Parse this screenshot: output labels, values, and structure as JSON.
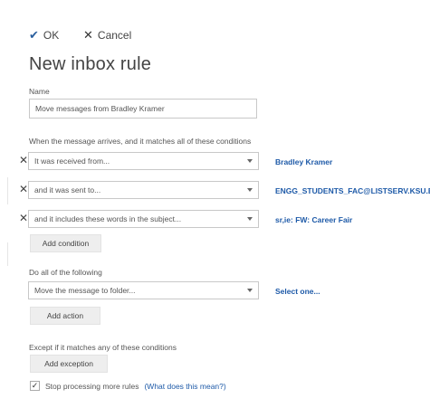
{
  "toolbar": {
    "ok_label": "OK",
    "cancel_label": "Cancel"
  },
  "page": {
    "title": "New inbox rule"
  },
  "name_section": {
    "label": "Name",
    "value": "Move messages from Bradley Kramer"
  },
  "conditions": {
    "heading": "When the message arrives, and it matches all of these conditions",
    "rows": [
      {
        "select": "It was received from...",
        "value": "Bradley Kramer"
      },
      {
        "select": "and it was sent to...",
        "value": "ENGG_STUDENTS_FAC@LISTSERV.KSU.EDU"
      },
      {
        "select": "and it includes these words in the subject...",
        "value": "sr,ie: FW: Career Fair"
      }
    ],
    "add_label": "Add condition"
  },
  "actions": {
    "heading": "Do all of the following",
    "select": "Move the message to folder...",
    "value": "Select one...",
    "add_label": "Add action"
  },
  "exceptions": {
    "heading": "Except if it matches any of these conditions",
    "add_label": "Add exception"
  },
  "stop_processing": {
    "checked": true,
    "check_glyph": "✓",
    "label": "Stop processing more rules",
    "help": "(What does this mean?)"
  },
  "icons": {
    "ok": "checkmark-icon",
    "cancel": "close-icon",
    "remove": "remove-icon",
    "dropdown": "chevron-down-icon"
  },
  "colors": {
    "link": "#1e5aa8",
    "accent": "#2b5f9e",
    "button_bg": "#eeeeee",
    "border": "#c8c8c8"
  }
}
